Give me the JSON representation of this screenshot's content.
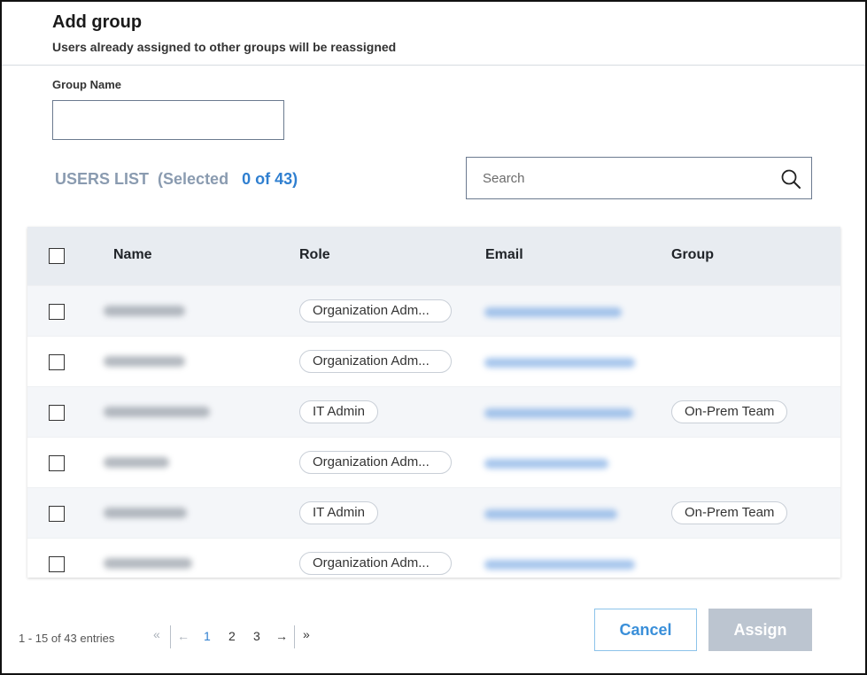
{
  "dialog": {
    "title": "Add group",
    "subtitle": "Users already assigned to other groups will be reassigned"
  },
  "form": {
    "group_name_label": "Group Name",
    "group_name_value": ""
  },
  "users_list": {
    "label": "USERS LIST",
    "selected_prefix": "(Selected",
    "selected_count": "0",
    "selected_suffix": "of 43)"
  },
  "search": {
    "placeholder": "Search",
    "icon": "search-icon"
  },
  "table": {
    "columns": [
      "Name",
      "Role",
      "Email",
      "Group"
    ],
    "rows": [
      {
        "role": "Organization Adm...",
        "group": ""
      },
      {
        "role": "Organization Adm...",
        "group": ""
      },
      {
        "role": "IT Admin",
        "group": "On-Prem Team"
      },
      {
        "role": "Organization Adm...",
        "group": ""
      },
      {
        "role": "IT Admin",
        "group": "On-Prem Team"
      },
      {
        "role": "Organization Adm...",
        "group": ""
      }
    ]
  },
  "pagination": {
    "info": "1 - 15 of 43 entries",
    "first": "«",
    "prev": "←",
    "pages": [
      "1",
      "2",
      "3"
    ],
    "current_page": "1",
    "next": "→",
    "last": "»"
  },
  "actions": {
    "cancel_label": "Cancel",
    "assign_label": "Assign"
  },
  "colors": {
    "accent": "#2f7fd0",
    "muted_heading": "#8a9bb0",
    "header_bg": "#e8ecf1",
    "assign_disabled": "#bcc5d0"
  }
}
